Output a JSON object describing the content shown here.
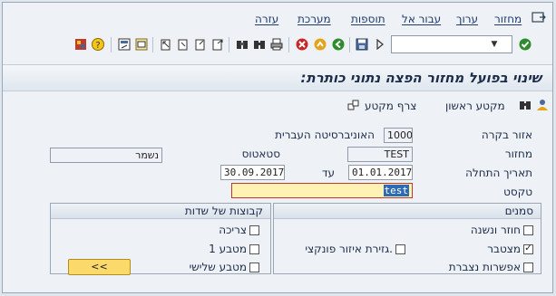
{
  "menu": {
    "items": [
      "מחזור",
      "ערוך",
      "עבור אל",
      "תוספות",
      "מערכת",
      "עזרה"
    ]
  },
  "icons": [
    "exit-icon",
    "ok-check-icon",
    "save-icon",
    "back-icon",
    "exit-red-icon",
    "cancel-icon",
    "print-icon",
    "find-icon",
    "find-next-icon",
    "first-page-icon",
    "prev-page-icon",
    "next-page-icon",
    "last-page-icon",
    "new-session-icon",
    "shortcut-icon",
    "help-icon",
    "customize-icon"
  ],
  "title": "שינוי בפועל מחזור הפצה נתוני כותרת:",
  "app_toolbar": {
    "first_segment_label": "מקטע ראשון",
    "attach_segment_label": "צרף מקטע"
  },
  "form": {
    "area_label": "אזור בקרה",
    "area_value": "1000",
    "area_desc": "האוניברסיטה העברית",
    "cycle_label": "מחזור",
    "cycle_value": "TEST",
    "status_label": "סטאטוס",
    "status_value": "נשמר",
    "start_date_label": "תאריך התחלה",
    "start_date_value": "01.01.2017",
    "to_label": "עד",
    "end_date_value": "30.09.2017",
    "text_label": "טקסט",
    "text_value": "test"
  },
  "flags_group": {
    "title": "סמנים",
    "items": [
      {
        "label": "חוזר ונשנה",
        "checked": false,
        "mark": ""
      },
      {
        "label": "מצטבר",
        "checked": true,
        "mark": "✓"
      },
      {
        "label": "אפשרות נצברת",
        "checked": false,
        "mark": ""
      },
      {
        "label": "גזירת איזור פונקצי.",
        "checked": false,
        "mark": ""
      }
    ]
  },
  "fieldgroups_group": {
    "title": "קבוצות של שדות",
    "items": [
      {
        "label": "צריכה",
        "checked": false,
        "mark": ""
      },
      {
        "label": "מטבע 1",
        "checked": false,
        "mark": ""
      },
      {
        "label": "מטבע שלישי",
        "checked": false,
        "mark": ""
      }
    ],
    "button_label": "<<"
  }
}
